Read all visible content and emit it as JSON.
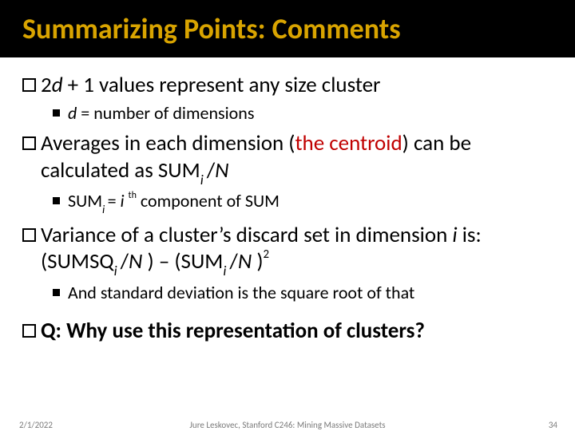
{
  "title": "Summarizing Points: Comments",
  "bullets": {
    "p1_pre": "2",
    "p1_var": "d",
    "p1_rest": " + 1 values represent any size cluster",
    "p1_sub_var": "d",
    "p1_sub_rest": "  = number of dimensions",
    "p2_a": "Averages in each dimension (",
    "p2_b": "the centroid",
    "p2_c": ") can be calculated as SUM",
    "p2_sub": "i ",
    "p2_d": "/",
    "p2_e": "N",
    "p2s_a": "SUM",
    "p2s_sub1": "i ",
    "p2s_b": "= ",
    "p2s_c": "i ",
    "p2s_sup": "th",
    "p2s_d": " component of SUM",
    "p3_a": "Variance of a cluster’s discard set in dimension ",
    "p3_b": "i",
    "p3_c": "  is: (SUMSQ",
    "p3_sub1": "i ",
    "p3_d": "/",
    "p3_e": "N ",
    "p3_f": ") – (SUM",
    "p3_sub2": "i ",
    "p3_g": "/",
    "p3_h": "N ",
    "p3_i": ")",
    "p3_sup": "2",
    "p3s": "And standard deviation is the square root of that",
    "p4_a": "Q:",
    "p4_b": " Why use this representation of clusters?"
  },
  "footer": {
    "date": "2/1/2022",
    "mid": "Jure Leskovec, Stanford C246: Mining Massive Datasets",
    "page": "34"
  }
}
